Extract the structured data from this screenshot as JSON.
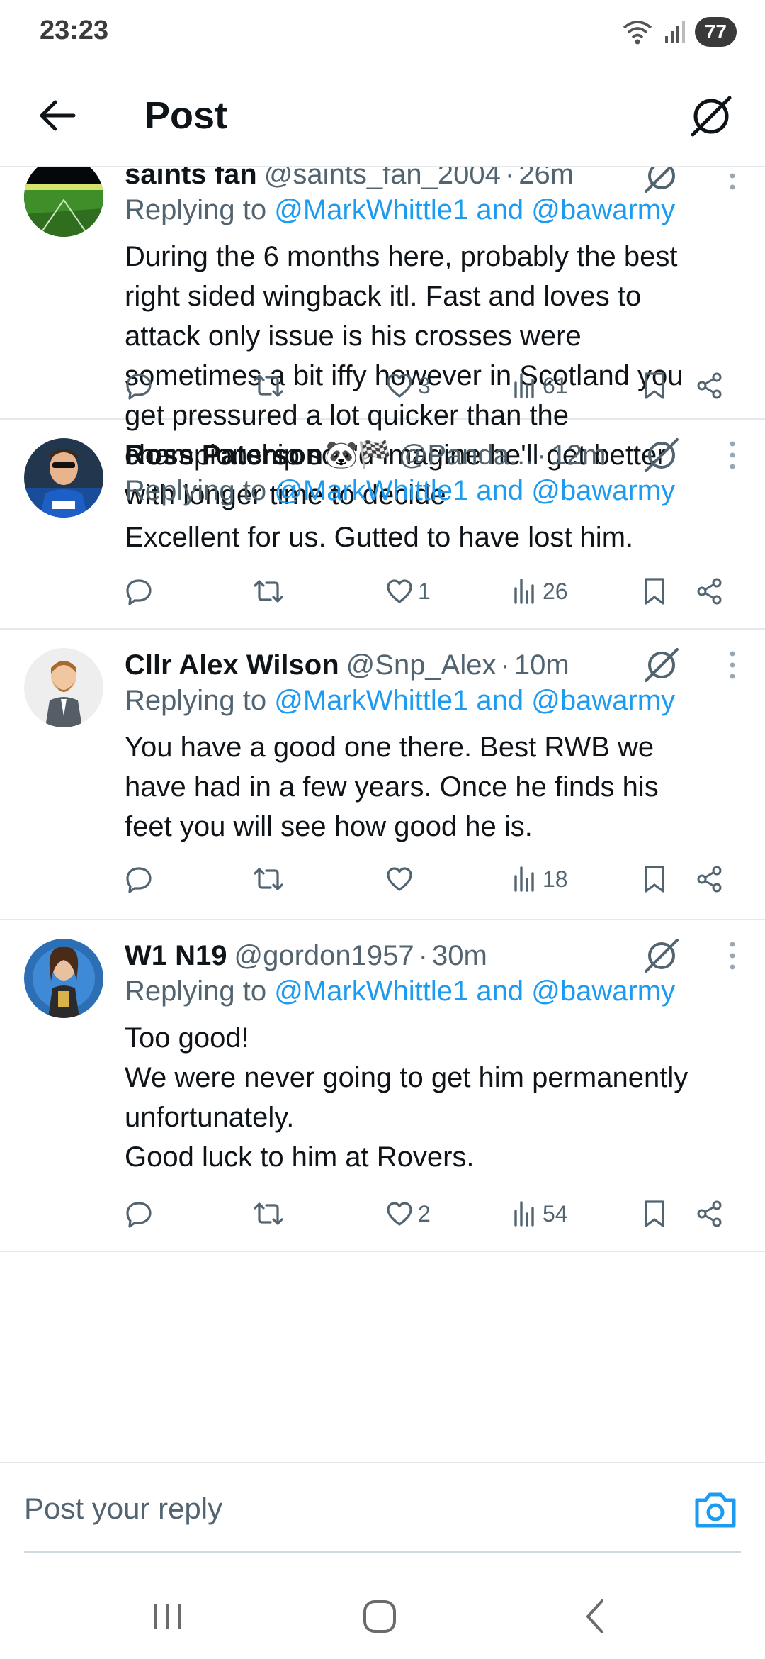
{
  "status_bar": {
    "time": "23:23",
    "battery": "77"
  },
  "header": {
    "title": "Post"
  },
  "replying_prefix": "Replying to",
  "replying_and": "and",
  "posts": [
    {
      "name": "saints fan",
      "emoji": "",
      "handle": "@saints_fan_2004",
      "time": "26m",
      "mentions": [
        "@MarkWhittle1",
        "@bawarmy"
      ],
      "text": "During the 6 months here, probably the best\nright sided wingback itl. Fast and loves to\nattack only issue is his crosses were\nsometimes a bit iffy however in Scotland you\nget pressured a lot quicker than the\nchampionship so I'd imagine he'll get better\nwith longer time to decide",
      "likes": "3",
      "views": "61"
    },
    {
      "name": "Ross Paterson",
      "emoji": "🐼🏁",
      "handle": "@Panda...",
      "time": "12m",
      "mentions": [
        "@MarkWhittle1",
        "@bawarmy"
      ],
      "text": "Excellent for us. Gutted to have lost him.",
      "likes": "1",
      "views": "26"
    },
    {
      "name": "Cllr Alex Wilson",
      "emoji": "",
      "handle": "@Snp_Alex",
      "time": "10m",
      "mentions": [
        "@MarkWhittle1",
        "@bawarmy"
      ],
      "text": "You have a good one there. Best RWB we\nhave had in a few years. Once he finds his\nfeet you will see how good he is.",
      "likes": "",
      "views": "18"
    },
    {
      "name": "W1 N19",
      "emoji": "",
      "handle": "@gordon1957",
      "time": "30m",
      "mentions": [
        "@MarkWhittle1",
        "@bawarmy"
      ],
      "text": "Too good!\nWe were never going to get him permanently\nunfortunately.\nGood luck to him at Rovers.",
      "likes": "2",
      "views": "54"
    }
  ],
  "reply_box": {
    "placeholder": "Post your reply"
  },
  "colors": {
    "accent": "#1d9bf0",
    "muted": "#536471",
    "text": "#0f1419",
    "divider": "#e6e9ec"
  },
  "icons": [
    "back-arrow-icon",
    "grok-icon",
    "more-icon",
    "reply-icon",
    "retweet-icon",
    "like-icon",
    "views-icon",
    "bookmark-icon",
    "share-icon",
    "camera-icon",
    "recents-icon",
    "home-icon",
    "nav-back-icon",
    "wifi-icon",
    "signal-icon"
  ]
}
